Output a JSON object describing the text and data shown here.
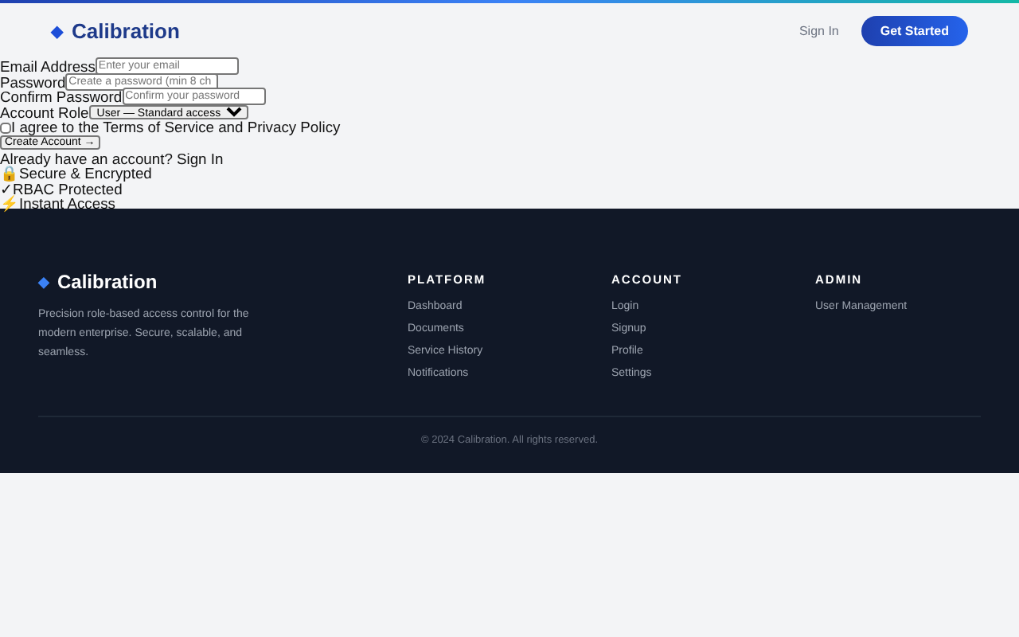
{
  "header": {
    "brand_icon": "◆",
    "brand": "Calibration",
    "sign_in": "Sign In",
    "get_started": "Get Started"
  },
  "form": {
    "fields": [
      {
        "label": "Email Address",
        "placeholder": "Enter your email"
      },
      {
        "label": "Password",
        "placeholder": "Create a password (min 8 ch"
      },
      {
        "label": "Confirm Password",
        "placeholder": "Confirm your password"
      }
    ],
    "role": {
      "label": "Account Role",
      "value": "User — Standard access"
    },
    "terms": {
      "label": "I agree to the Terms of Service and Privacy Policy",
      "checked": false
    },
    "submit": "Create Account →",
    "signin_prompt": "Already have an account? Sign In",
    "features": [
      {
        "icon": "🔒",
        "text": "Secure & Encrypted"
      },
      {
        "icon": "✓",
        "text": "RBAC Protected"
      },
      {
        "icon": "⚡",
        "text": "Instant Access"
      }
    ]
  },
  "footer": {
    "brand_icon": "◆",
    "brand": "Calibration",
    "tagline": "Precision role-based access control for the modern enterprise. Secure, scalable, and seamless.",
    "columns": [
      {
        "title": "PLATFORM",
        "links": [
          "Dashboard",
          "Documents",
          "Service History",
          "Notifications"
        ]
      },
      {
        "title": "ACCOUNT",
        "links": [
          "Login",
          "Signup",
          "Profile",
          "Settings"
        ]
      },
      {
        "title": "ADMIN",
        "links": [
          "User Management"
        ]
      }
    ],
    "copyright": "© 2024 Calibration. All rights reserved."
  }
}
